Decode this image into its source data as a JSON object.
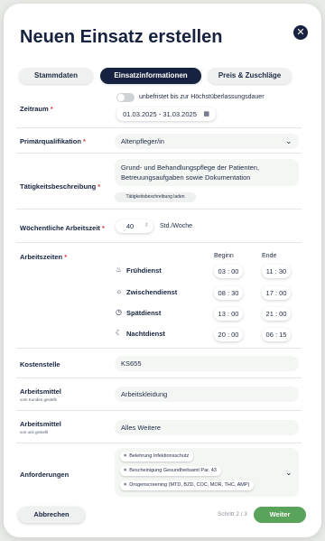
{
  "modal": {
    "title": "Neuen Einsatz erstellen"
  },
  "tabs": [
    {
      "label": "Stammdaten"
    },
    {
      "label": "Einsatzinformationen"
    },
    {
      "label": "Preis & Zuschläge"
    }
  ],
  "zeitraum": {
    "label": "Zeitraum",
    "toggle_label": "unbefristet bis zur Höchstüberlassungsdauer",
    "date_range": "01.03.2025 - 31.03.2025"
  },
  "primaerqualifikation": {
    "label": "Primärqualifikation",
    "value": "Altenpfleger/in"
  },
  "taetigkeit": {
    "label": "Tätigkeitsbeschreibung",
    "value_line1": "Grund- und Behandlungspflege der Patienten,",
    "value_line2": "Betreuungsaufgaben sowie Dokumentation",
    "load_button": "Tätigkeitsbeschreibung laden"
  },
  "arbeitszeit": {
    "label": "Wöchentliche Arbeitszeit",
    "value": "40",
    "unit": "Std./Woche"
  },
  "arbeitszeiten": {
    "label": "Arbeitszeiten",
    "col_begin": "Beginn",
    "col_end": "Ende",
    "shifts": [
      {
        "name": "Frühdienst",
        "icon": "sunrise-icon",
        "begin": "03 : 00",
        "end": "11 : 30"
      },
      {
        "name": "Zwischendienst",
        "icon": "sun-icon",
        "begin": "08 : 30",
        "end": "17 : 00"
      },
      {
        "name": "Spätdienst",
        "icon": "clock-icon",
        "begin": "13 : 00",
        "end": "21 : 00"
      },
      {
        "name": "Nachtdienst",
        "icon": "moon-icon",
        "begin": "20 : 00",
        "end": "06 : 15"
      }
    ]
  },
  "kostenstelle": {
    "label": "Kostenstelle",
    "value": "KS655"
  },
  "arbeitsmittel_kunde": {
    "label": "Arbeitsmittel",
    "sub": "vom Kunden gestellt",
    "value": "Arbeitskleidung"
  },
  "arbeitsmittel_uns": {
    "label": "Arbeitsmittel",
    "sub": "von uns gestellt",
    "value": "Alles Weitere"
  },
  "anforderungen": {
    "label": "Anforderungen",
    "chips": [
      "Belehrung Infektionsschutz",
      "Bescheinigung Gesundheitsamt Par. 43",
      "Drogenscreening (MTD, BZD, COC, MOR, THC, AMP)"
    ]
  },
  "footer": {
    "cancel": "Abbrechen",
    "step": "Schritt 2 / 3",
    "next": "Weiter"
  },
  "colors": {
    "primary": "#16223f",
    "accent_green": "#5aa35a",
    "required": "#d93a3a"
  }
}
